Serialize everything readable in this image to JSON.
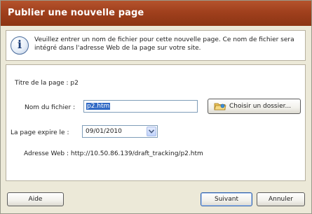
{
  "dialog": {
    "title": "Publier une nouvelle page",
    "title_bar_color": "#a0401d",
    "info_icon": "info-icon",
    "info_message": "Veuillez entrer un nom de fichier pour cette nouvelle page. Ce nom de fichier sera intégré dans l'adresse Web de la page sur votre site."
  },
  "form": {
    "page_title_label": "Titre de la page : p2",
    "file_name_label": "Nom du fichier :",
    "file_name_value": "p2.htm",
    "choose_folder_icon": "folder-icon",
    "choose_folder_label": "Choisir un dossier...",
    "expire_label": "La page expire le :",
    "expire_value": "09/01/2010",
    "expire_dropdown_icon": "chevron-down-icon",
    "web_address_label": "Adresse Web : http://10.50.86.139/draft_tracking/p2.htm"
  },
  "footer": {
    "help_label": "Aide",
    "next_label": "Suivant",
    "cancel_label": "Annuler"
  }
}
